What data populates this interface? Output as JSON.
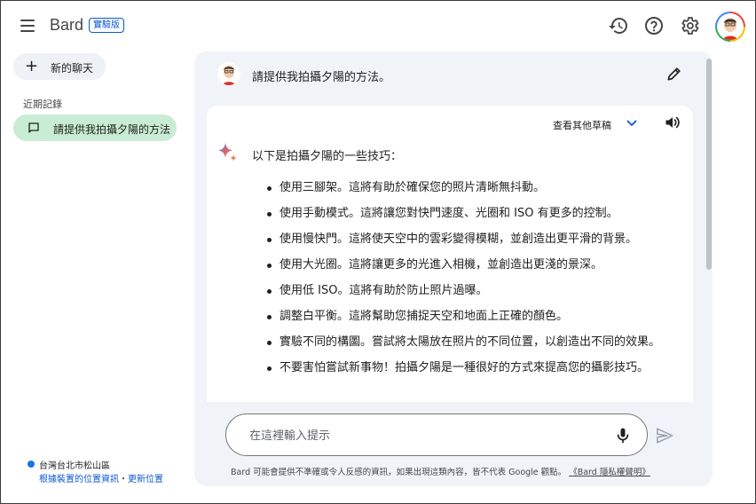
{
  "header": {
    "brand": "Bard",
    "badge": "實驗版",
    "icons": [
      "history-icon",
      "help-icon",
      "settings-icon"
    ]
  },
  "sidebar": {
    "new_chat_label": "新的聊天",
    "recent_title": "近期記錄",
    "recent_items": [
      {
        "label": "請提供我拍攝夕陽的方法"
      }
    ],
    "location": {
      "place": "台灣台北市松山區",
      "link_device": "根據裝置的位置資訊",
      "separator": "・",
      "link_update": "更新位置"
    }
  },
  "chat": {
    "prompt": "請提供我拍攝夕陽的方法。",
    "response": {
      "drafts_label": "查看其他草稿",
      "intro": "以下是拍攝夕陽的一些技巧：",
      "tips": [
        "使用三腳架。這將有助於確保您的照片清晰無抖動。",
        "使用手動模式。這將讓您對快門速度、光圈和 ISO 有更多的控制。",
        "使用慢快門。這將使天空中的雲彩變得模糊，並創造出更平滑的背景。",
        "使用大光圈。這將讓更多的光進入相機，並創造出更淺的景深。",
        "使用低 ISO。這將有助於防止照片過曝。",
        "調整白平衡。這將幫助您捕捉天空和地面上正確的顏色。",
        "實驗不同的構圖。嘗試將太陽放在照片的不同位置，以創造出不同的效果。",
        "不要害怕嘗試新事物！拍攝夕陽是一種很好的方式來提高您的攝影技巧。"
      ]
    }
  },
  "composer": {
    "placeholder": "在這裡輸入提示",
    "value": ""
  },
  "footer": {
    "disclaimer": "Bard 可能會提供不準確或令人反感的資訊，如果出現這類內容，皆不代表 Google 觀點。",
    "privacy_link": "《Bard 隱私權聲明》"
  },
  "colors": {
    "accent": "#0b57d0",
    "selected_item": "#c9ecd4",
    "panel_bg": "#f0f4f9"
  }
}
